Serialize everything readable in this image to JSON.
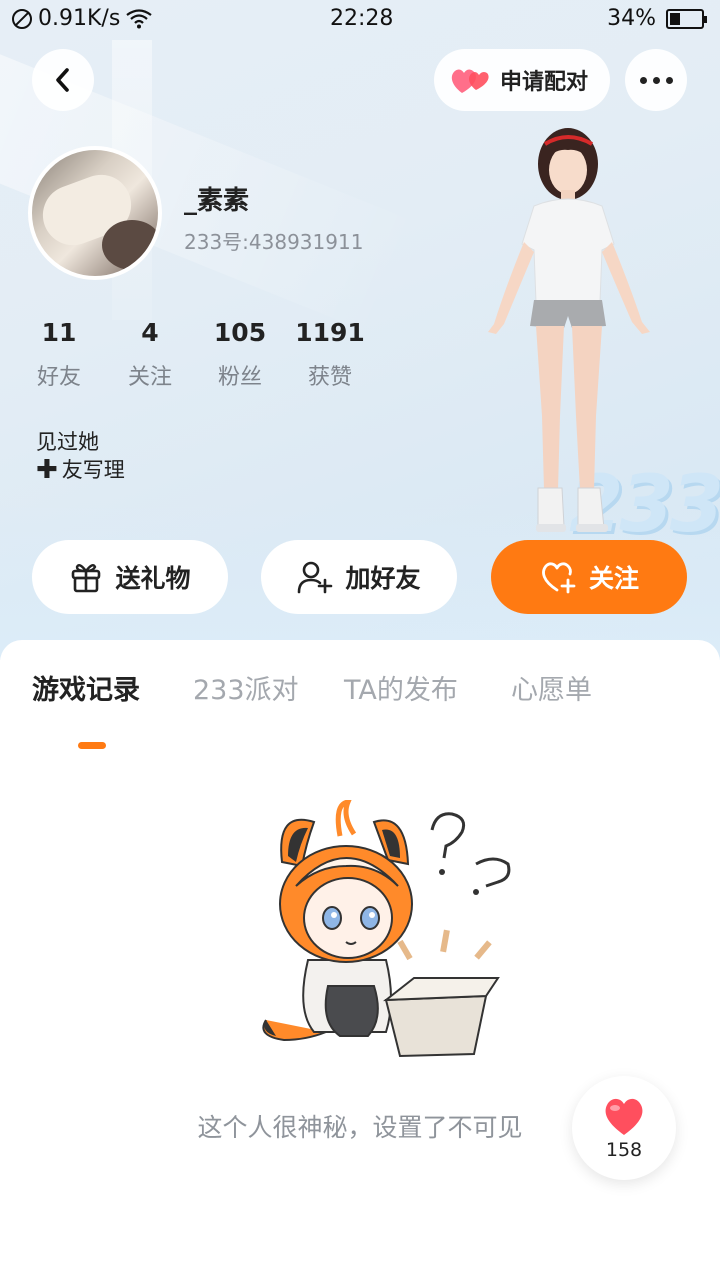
{
  "status_bar": {
    "net_speed": "0.91K/s",
    "time": "22:28",
    "battery": "34%",
    "battery_level": 0.34
  },
  "header": {
    "back_icon": "chevron-left-icon",
    "match_label": "申请配对",
    "more_icon": "more-dots-icon"
  },
  "profile": {
    "username": "_素素",
    "uid": "233号:438931911",
    "stats": [
      {
        "value": "11",
        "label": "好友"
      },
      {
        "value": "4",
        "label": "关注"
      },
      {
        "value": "105",
        "label": "粉丝"
      },
      {
        "value": "1191",
        "label": "获赞"
      }
    ],
    "seen_label": "见过她",
    "write_friend_label": "友写理"
  },
  "actions": {
    "gift_label": "送礼物",
    "add_friend_label": "加好友",
    "follow_label": "关注"
  },
  "tabs": [
    {
      "label": "游戏记录",
      "active": true
    },
    {
      "label": "233派对",
      "active": false
    },
    {
      "label": "TA的发布",
      "active": false
    },
    {
      "label": "心愿单",
      "active": false
    }
  ],
  "empty_state": {
    "message": "这个人很神秘，设置了不可见"
  },
  "like_fab": {
    "count": "158"
  },
  "colors": {
    "accent": "#ff7a12",
    "heart": "#ff4f5e",
    "muted_text": "#8f949b"
  }
}
